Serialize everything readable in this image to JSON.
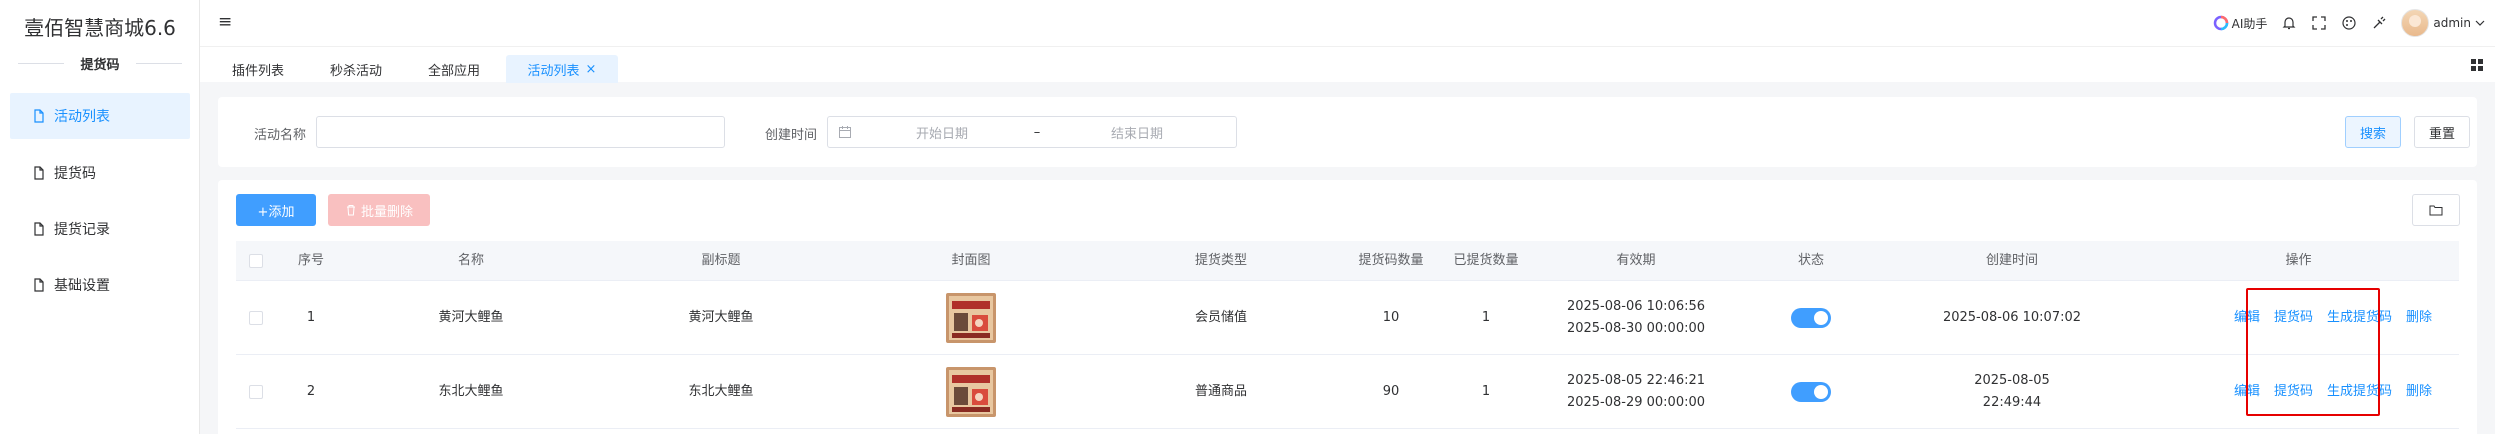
{
  "sidebar": {
    "brand": "壹佰智慧商城6.6",
    "section_title": "提货码",
    "items": [
      {
        "label": "活动列表",
        "active": true
      },
      {
        "label": "提货码",
        "active": false
      },
      {
        "label": "提货记录",
        "active": false
      },
      {
        "label": "基础设置",
        "active": false
      }
    ]
  },
  "header": {
    "menu_icon": "hamburger-icon",
    "ai_label": "AI助手",
    "user_name": "admin"
  },
  "tabs": [
    {
      "label": "插件列表"
    },
    {
      "label": "秒杀活动"
    },
    {
      "label": "全部应用"
    },
    {
      "label": "活动列表",
      "active": true,
      "close": "×"
    }
  ],
  "search": {
    "name_label": "活动名称",
    "name_value": "",
    "time_label": "创建时间",
    "start_placeholder": "开始日期",
    "separator": "–",
    "end_placeholder": "结束日期",
    "search_btn": "搜索",
    "reset_btn": "重置"
  },
  "toolbar": {
    "add_label": "+添加",
    "batch_delete_label": "批量删除"
  },
  "table": {
    "columns": [
      "序号",
      "名称",
      "副标题",
      "封面图",
      "提货类型",
      "提货码数量",
      "已提货数量",
      "有效期",
      "状态",
      "创建时间",
      "操作"
    ],
    "rows": [
      {
        "index": "1",
        "name": "黄河大鲤鱼",
        "subtitle": "黄河大鲤鱼",
        "type": "会员储值",
        "code_count": "10",
        "picked_count": "1",
        "valid_start": "2025-08-06 10:06:56",
        "valid_end": "2025-08-30 00:00:00",
        "status_on": true,
        "created_line1": "2025-08-06 10:07:02",
        "created_line2": ""
      },
      {
        "index": "2",
        "name": "东北大鲤鱼",
        "subtitle": "东北大鲤鱼",
        "type": "普通商品",
        "code_count": "90",
        "picked_count": "1",
        "valid_start": "2025-08-05 22:46:21",
        "valid_end": "2025-08-29 00:00:00",
        "status_on": true,
        "created_line1": "2025-08-05",
        "created_line2": "22:49:44"
      }
    ],
    "actions": {
      "edit": "编辑",
      "pickup_code": "提货码",
      "generate_code": "生成提货码",
      "delete": "删除"
    }
  },
  "colors": {
    "primary": "#1890ff",
    "active_bg": "#e8f3ff",
    "danger_light": "#f9c0c0",
    "highlight": "#e60000"
  }
}
